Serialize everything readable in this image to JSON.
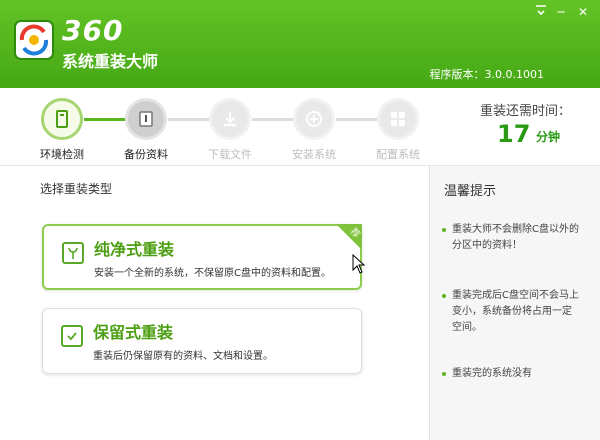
{
  "window": {
    "menu_icon": "menu-icon",
    "min_label": "─",
    "close_label": "✕"
  },
  "header": {
    "brand_number": "360",
    "brand_name": "系统重装大师",
    "version": "程序版本：3.0.0.1001"
  },
  "steps": [
    {
      "label": "环境检测",
      "icon": "monitor-icon",
      "state": "done"
    },
    {
      "label": "备份资料",
      "icon": "backup-icon",
      "state": "current"
    },
    {
      "label": "下载文件",
      "icon": "download-icon",
      "state": "pending"
    },
    {
      "label": "安装系统",
      "icon": "install-icon",
      "state": "pending"
    },
    {
      "label": "配置系统",
      "icon": "windows-icon",
      "state": "pending"
    }
  ],
  "time": {
    "title": "重装还需时间：",
    "value": "17",
    "unit": "分钟"
  },
  "main": {
    "title": "选择重装类型",
    "cards": [
      {
        "title": "纯净式重装",
        "desc": "安装一个全新的系统，不保留原C盘中的资料和配置。",
        "badge": "荐",
        "selected": true
      },
      {
        "title": "保留式重装",
        "desc": "重装后仍保留原有的资料、文档和设置。",
        "selected": false
      }
    ]
  },
  "sidebar": {
    "title": "温馨提示",
    "tips": [
      "重装大师不会删除C盘以外的分区中的资料！",
      "重装完成后C盘空间不会马上变小，系统备份将占用一定空间。",
      "重装完的系统没有"
    ]
  },
  "colors": {
    "header": "#45a814",
    "accent": "#4c9e12",
    "time": "#2a9a14"
  }
}
